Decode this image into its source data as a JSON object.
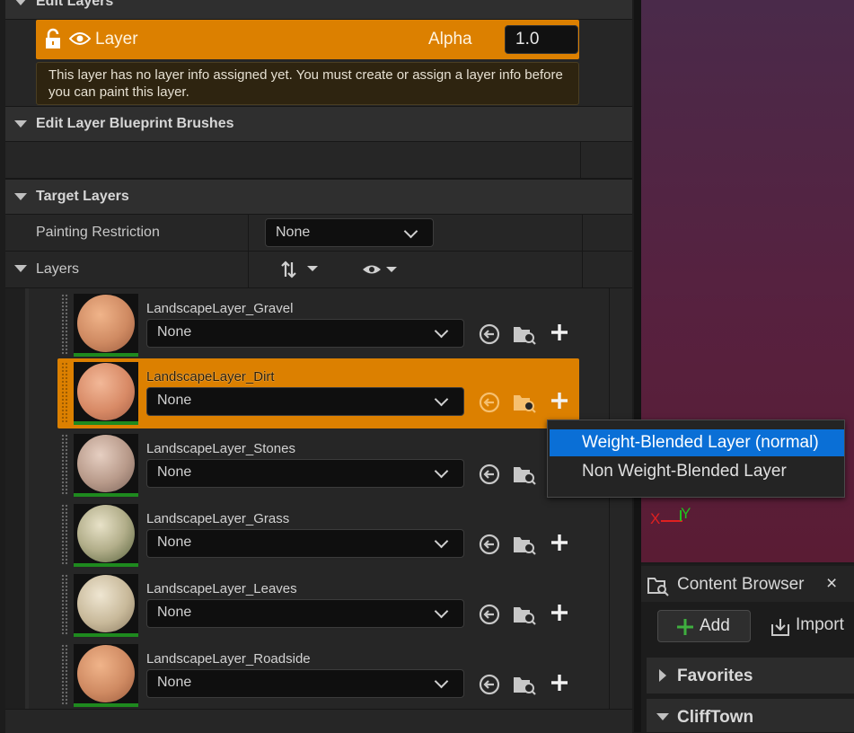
{
  "sections": {
    "edit_layers": "Edit Layers",
    "edit_layer_bp_brushes": "Edit Layer Blueprint Brushes",
    "target_layers": "Target Layers"
  },
  "edit_layer": {
    "name": "Layer",
    "alpha_label": "Alpha",
    "alpha_value": "1.0",
    "warning": "This layer has no layer info assigned yet. You must create or assign a layer info before you can paint this layer."
  },
  "painting_restriction": {
    "label": "Painting Restriction",
    "value": "None"
  },
  "layers_header": {
    "label": "Layers"
  },
  "layers": [
    {
      "name": "LandscapeLayer_Gravel",
      "value": "None",
      "selected": false
    },
    {
      "name": "LandscapeLayer_Dirt",
      "value": "None",
      "selected": true
    },
    {
      "name": "LandscapeLayer_Stones",
      "value": "None",
      "selected": false
    },
    {
      "name": "LandscapeLayer_Grass",
      "value": "None",
      "selected": false
    },
    {
      "name": "LandscapeLayer_Leaves",
      "value": "None",
      "selected": false
    },
    {
      "name": "LandscapeLayer_Roadside",
      "value": "None",
      "selected": false
    }
  ],
  "popup_menu": {
    "items": [
      "Weight-Blended Layer (normal)",
      "Non Weight-Blended Layer"
    ],
    "highlighted_index": 0
  },
  "viewport": {
    "axis_x": "X",
    "axis_y": "Y"
  },
  "content_browser": {
    "title": "Content Browser",
    "close": "×",
    "add_label": "Add",
    "import_label": "Import",
    "folders": [
      "Favorites",
      "CliffTown"
    ]
  },
  "colors": {
    "accent_orange": "#dc8000",
    "selection_blue": "#0a6fd6",
    "viewport_top": "#4a2a4a",
    "viewport_bottom": "#5a1c34",
    "valid_green": "#1e8a1e"
  }
}
